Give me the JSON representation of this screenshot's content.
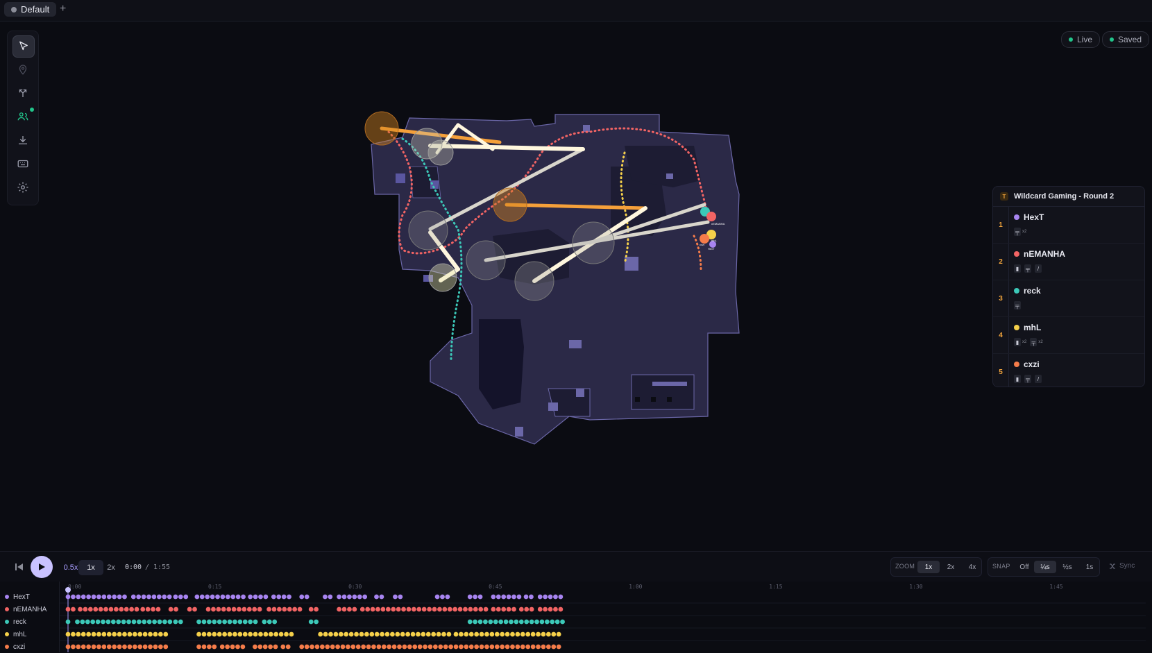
{
  "tabs": [
    {
      "label": "Default",
      "active": true
    }
  ],
  "add_tab_label": "+",
  "toolbar": {
    "tools": [
      {
        "name": "select-tool",
        "icon": "cursor-arrow-icon",
        "active": true
      },
      {
        "name": "marker-tool",
        "icon": "map-pin-icon",
        "active": false
      },
      {
        "name": "route-tool",
        "icon": "branch-arrows-icon",
        "active": false
      },
      {
        "name": "players-tool",
        "icon": "users-icon",
        "active": false,
        "badge": true
      },
      {
        "name": "download-tool",
        "icon": "download-icon",
        "active": false
      },
      {
        "name": "keyboard-tool",
        "icon": "keyboard-icon",
        "active": false
      },
      {
        "name": "settings-tool",
        "icon": "gear-icon",
        "active": false
      }
    ]
  },
  "status": {
    "live_label": "Live",
    "saved_label": "Saved",
    "indicator_color": "#22c58b"
  },
  "round_panel": {
    "side_badge": "T",
    "title": "Wildcard Gaming - Round 2",
    "players": [
      {
        "rank": "1",
        "name": "HexT",
        "color": "#a784f0",
        "items": [
          "pistol-x2"
        ],
        "item_count": "x2"
      },
      {
        "rank": "2",
        "name": "nEMANHA",
        "color": "#f26464",
        "items": [
          "grenade",
          "pistol",
          "knife"
        ]
      },
      {
        "rank": "3",
        "name": "reck",
        "color": "#3cc8b8",
        "items": [
          "pistol"
        ]
      },
      {
        "rank": "4",
        "name": "mhL",
        "color": "#f5d04a",
        "items": [
          "grenade-x2",
          "pistol-x2"
        ],
        "item_count": "x2"
      },
      {
        "rank": "5",
        "name": "cxzi",
        "color": "#f57c4a",
        "items": [
          "grenade",
          "pistol",
          "knife"
        ]
      }
    ]
  },
  "playback": {
    "speeds": [
      "0.5x",
      "1x",
      "2x"
    ],
    "active_speed": "1x",
    "current_time": "0:00",
    "separator": "/",
    "total_time": "1:55",
    "zoom_label": "ZOOM",
    "zoom_options": [
      "1x",
      "2x",
      "4x"
    ],
    "active_zoom": "1x",
    "snap_label": "SNAP",
    "snap_options": [
      "Off",
      "¼s",
      "½s",
      "1s"
    ],
    "active_snap": "¼s",
    "sync_label": "Sync"
  },
  "timeline": {
    "ticks": [
      "0:00",
      "0:15",
      "0:30",
      "0:45",
      "1:00",
      "1:15",
      "1:30",
      "1:45"
    ],
    "players": [
      "HexT",
      "nEMANHA",
      "reck",
      "mhL",
      "cxzi"
    ]
  },
  "map_labels": {
    "n": "nEMANHA",
    "m": "mhL",
    "c": "cxzi",
    "h": "HexT"
  }
}
